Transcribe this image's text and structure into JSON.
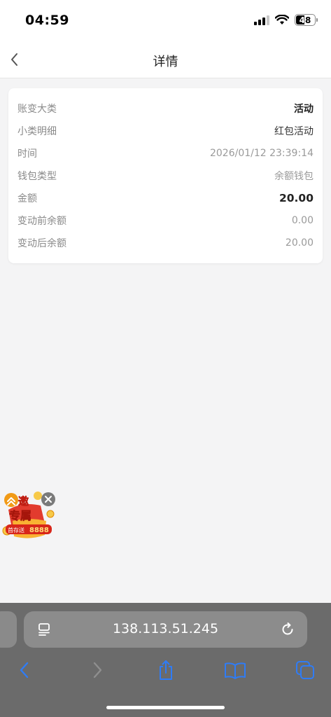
{
  "status_bar": {
    "time": "04:59",
    "battery": "48"
  },
  "nav": {
    "title": "详情"
  },
  "details": [
    {
      "label": "账变大类",
      "value": "活动"
    },
    {
      "label": "小类明细",
      "value": "红包活动"
    },
    {
      "label": "时间",
      "value": "2026/01/12 23:39:14"
    },
    {
      "label": "钱包类型",
      "value": "余额钱包"
    },
    {
      "label": "金额",
      "value": "20.00"
    },
    {
      "label": "变动前余额",
      "value": "0.00"
    },
    {
      "label": "变动后余额",
      "value": "20.00"
    }
  ],
  "promo": {
    "line1": "邀",
    "line2": "专属",
    "badge": "首存送",
    "amount": "8888"
  },
  "browser": {
    "url": "138.113.51.245"
  },
  "colors": {
    "accent_blue": "#2f7cf6",
    "promo_red": "#e23b2e",
    "promo_gold": "#f7c948"
  }
}
